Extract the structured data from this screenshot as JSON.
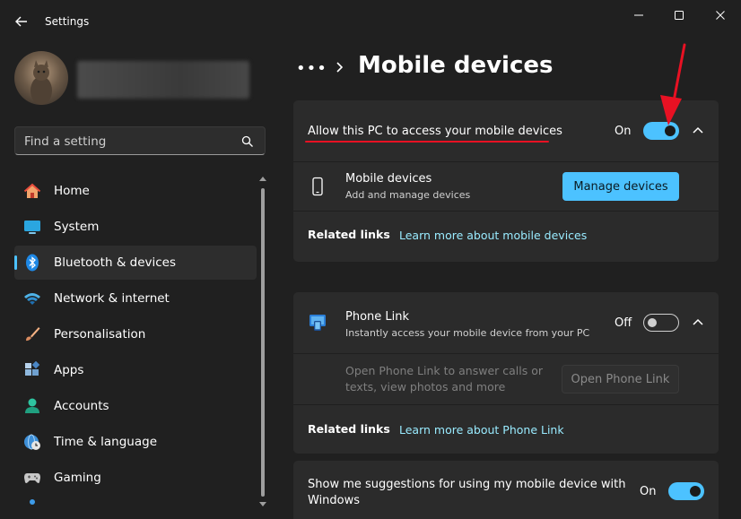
{
  "window": {
    "title": "Settings",
    "back_icon": "back-arrow-icon",
    "minimize_icon": "minimize-icon",
    "maximize_icon": "maximize-icon",
    "close_icon": "close-icon"
  },
  "search": {
    "placeholder": "Find a setting",
    "icon": "search-icon"
  },
  "nav": {
    "items": [
      {
        "label": "Home",
        "icon": "home-icon"
      },
      {
        "label": "System",
        "icon": "system-icon"
      },
      {
        "label": "Bluetooth & devices",
        "icon": "bluetooth-icon",
        "active": true
      },
      {
        "label": "Network & internet",
        "icon": "wifi-icon"
      },
      {
        "label": "Personalisation",
        "icon": "brush-icon"
      },
      {
        "label": "Apps",
        "icon": "apps-icon"
      },
      {
        "label": "Accounts",
        "icon": "accounts-icon"
      },
      {
        "label": "Time & language",
        "icon": "globe-clock-icon"
      },
      {
        "label": "Gaming",
        "icon": "gamepad-icon"
      }
    ]
  },
  "header": {
    "more": "•••",
    "title": "Mobile devices"
  },
  "card1": {
    "allow_label": "Allow this PC to access your mobile devices",
    "allow_state": "On",
    "mobile_devices_title": "Mobile devices",
    "mobile_devices_sub": "Add and manage devices",
    "manage_button": "Manage devices",
    "related_links": "Related links",
    "learn_more": "Learn more about mobile devices"
  },
  "card2": {
    "phone_link_title": "Phone Link",
    "phone_link_sub": "Instantly access your mobile device from your PC",
    "phone_link_state": "Off",
    "open_text_line1": "Open Phone Link to answer calls or",
    "open_text_line2": "texts, view photos and more",
    "open_button": "Open Phone Link",
    "related_links": "Related links",
    "learn_more": "Learn more about Phone Link"
  },
  "card3": {
    "suggestions_line1": "Show me suggestions for using my mobile device with",
    "suggestions_line2": "Windows",
    "suggestions_state": "On"
  },
  "colors": {
    "accent": "#4cc2ff",
    "annotation": "#e81123"
  }
}
